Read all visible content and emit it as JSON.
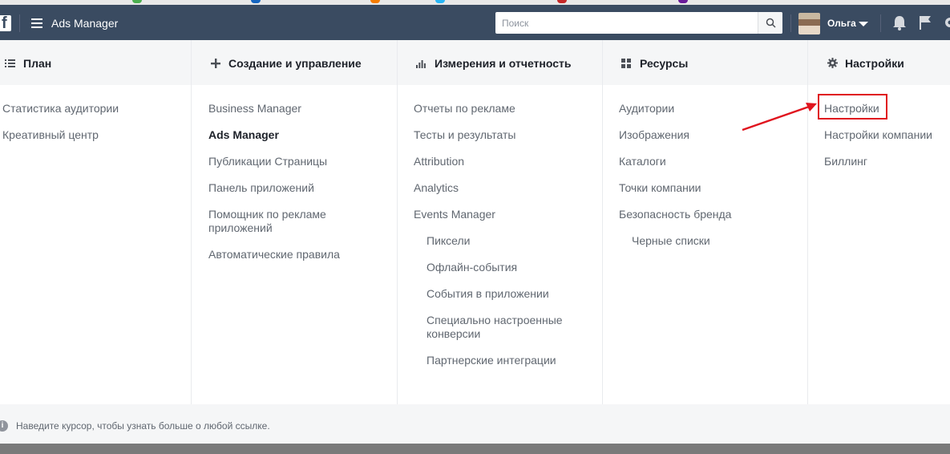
{
  "topbar": {
    "logo": "f",
    "app_title": "Ads Manager",
    "search_placeholder": "Поиск",
    "user_name": "Ольга"
  },
  "columns": [
    {
      "icon": "list-icon",
      "title": "План",
      "items": [
        {
          "label": "Статистика аудитории"
        },
        {
          "label": "Креативный центр"
        }
      ]
    },
    {
      "icon": "plus-icon",
      "title": "Создание и управление",
      "items": [
        {
          "label": "Business Manager"
        },
        {
          "label": "Ads Manager",
          "active": true
        },
        {
          "label": "Публикации Страницы"
        },
        {
          "label": "Панель приложений"
        },
        {
          "label": "Помощник по рекламе\nприложений"
        },
        {
          "label": "Автоматические правила"
        }
      ]
    },
    {
      "icon": "bar-chart-icon",
      "title": "Измерения и отчетность",
      "items": [
        {
          "label": "Отчеты по рекламе"
        },
        {
          "label": "Тесты и результаты"
        },
        {
          "label": "Attribution"
        },
        {
          "label": "Analytics"
        },
        {
          "label": "Events Manager"
        },
        {
          "label": "Пиксели",
          "sub": true
        },
        {
          "label": "Офлайн-события",
          "sub": true
        },
        {
          "label": "События в приложении",
          "sub": true
        },
        {
          "label": "Специально настроенные\nконверсии",
          "sub": true
        },
        {
          "label": "Партнерские интеграции",
          "sub": true
        }
      ]
    },
    {
      "icon": "grid-icon",
      "title": "Ресурсы",
      "items": [
        {
          "label": "Аудитории"
        },
        {
          "label": "Изображения"
        },
        {
          "label": "Каталоги"
        },
        {
          "label": "Точки компании"
        },
        {
          "label": "Безопасность бренда"
        },
        {
          "label": "Черные списки",
          "sub": true
        }
      ]
    },
    {
      "icon": "gear-icon",
      "title": "Настройки",
      "items": [
        {
          "label": "Настройки",
          "highlighted": true
        },
        {
          "label": "Настройки компании"
        },
        {
          "label": "Биллинг"
        }
      ]
    }
  ],
  "footer": {
    "info_text": "Наведите курсор, чтобы узнать больше о любой ссылке."
  },
  "colors": {
    "topbar": "#3a4b61",
    "header_bg": "#f5f6f7",
    "annotation_red": "#e0141e"
  }
}
